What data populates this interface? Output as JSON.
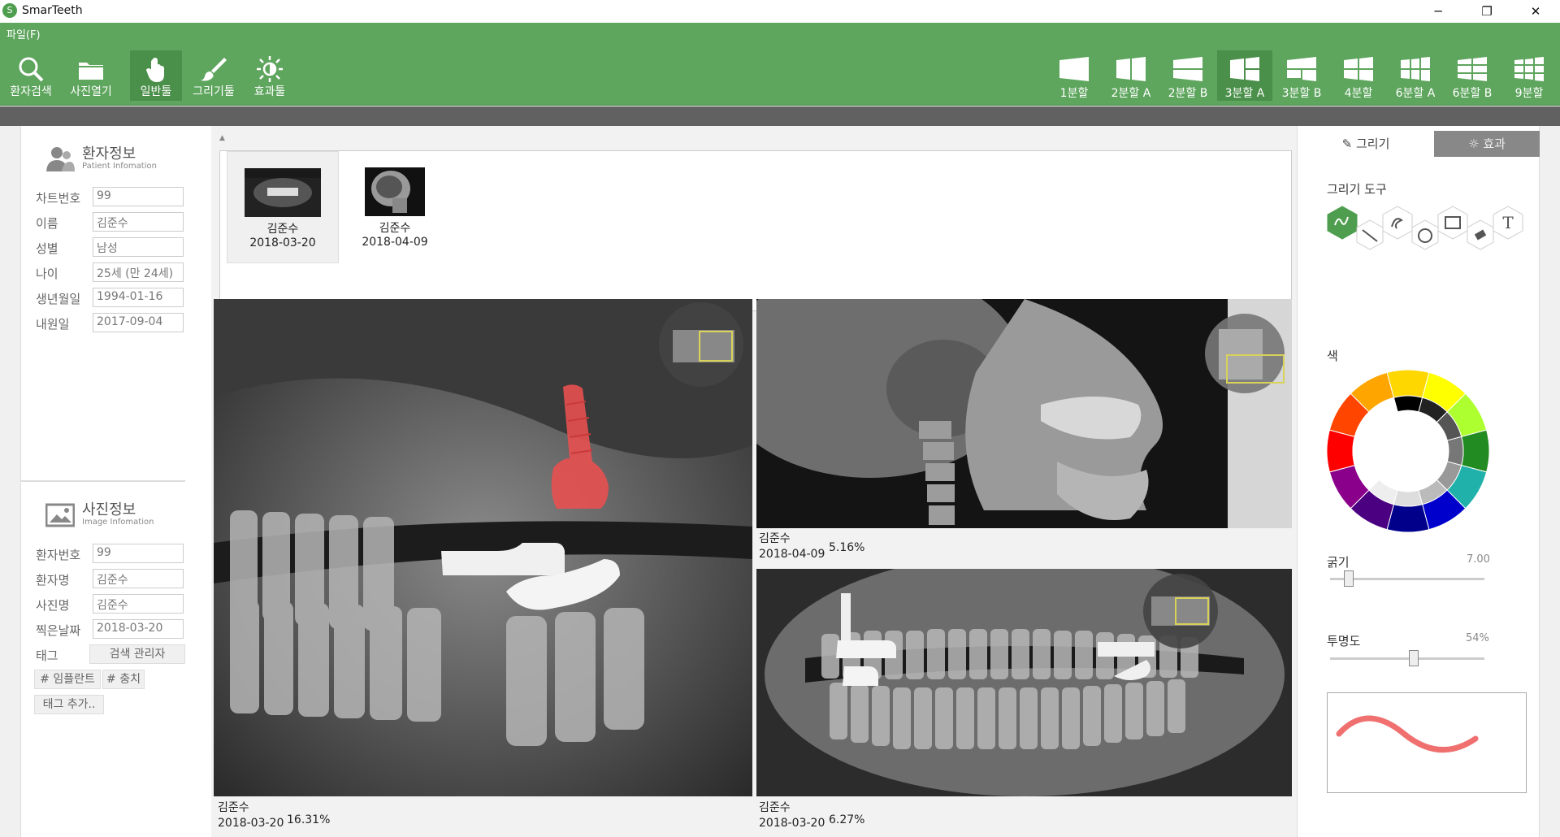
{
  "app": {
    "title": "SmarTeeth",
    "icon_label": "S"
  },
  "window_controls": {
    "minimize": "─",
    "restore": "❐",
    "close": "✕"
  },
  "menu": {
    "file": "파일(F)"
  },
  "toolbar": {
    "tools": [
      {
        "label": "환자검색",
        "icon": "search-icon"
      },
      {
        "label": "사진열기",
        "icon": "folder-icon"
      },
      {
        "label": "일반툴",
        "icon": "hand-icon",
        "active": true
      },
      {
        "label": "그리기툴",
        "icon": "brush-icon"
      },
      {
        "label": "효과툴",
        "icon": "sun-icon"
      }
    ],
    "splits": [
      "1분할",
      "2분할 A",
      "2분할 B",
      "3분할 A",
      "3분할 B",
      "4분할",
      "6분할 A",
      "6분할 B",
      "9분할"
    ],
    "active_split": "3분할 A"
  },
  "patient": {
    "title": "환자정보",
    "subtitle": "Patient Infomation",
    "fields": [
      {
        "label": "차트번호",
        "value": "99"
      },
      {
        "label": "이름",
        "value": "김준수"
      },
      {
        "label": "성별",
        "value": "남성"
      },
      {
        "label": "나이",
        "value": "25세 (만 24세)"
      },
      {
        "label": "생년월일",
        "value": "1994-01-16"
      },
      {
        "label": "내원일",
        "value": "2017-09-04"
      }
    ]
  },
  "image_info": {
    "title": "사진정보",
    "subtitle": "Image Infomation",
    "fields": [
      {
        "label": "환자번호",
        "value": "99"
      },
      {
        "label": "환자명",
        "value": "김준수"
      },
      {
        "label": "사진명",
        "value": "김준수"
      },
      {
        "label": "찍은날짜",
        "value": "2018-03-20"
      }
    ],
    "tag_label": "태그",
    "tag_manager": "검색 관리자",
    "tags": [
      "# 임플란트",
      "# 충치"
    ],
    "add_tag": "태그 추가.."
  },
  "thumbnails": [
    {
      "name": "김준수",
      "date": "2018-03-20",
      "selected": true
    },
    {
      "name": "김준수",
      "date": "2018-04-09",
      "selected": false
    }
  ],
  "viewers": [
    {
      "name": "김준수",
      "date": "2018-03-20",
      "zoom": "16.31%"
    },
    {
      "name": "김준수",
      "date": "2018-04-09",
      "zoom": "5.16%"
    },
    {
      "name": "김준수",
      "date": "2018-03-20",
      "zoom": "6.27%"
    }
  ],
  "right": {
    "tab_draw": "그리기",
    "tab_fx": "효과",
    "draw_tools_label": "그리기 도구",
    "color_label": "색",
    "thickness_label": "굵기",
    "thickness_value": "7.00",
    "thickness_level": 0.12,
    "opacity_label": "투명도",
    "opacity_value": "54%",
    "opacity_level": 0.54,
    "preview_color": "#f07070"
  },
  "colors": {
    "toolbar": "#5ea55e",
    "accent_dark": "#4a8f4a",
    "implant": "#e85050"
  }
}
